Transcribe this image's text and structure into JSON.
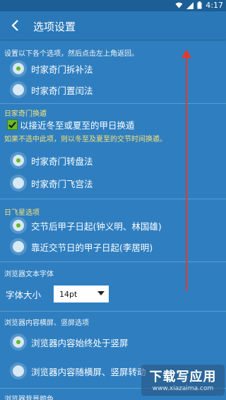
{
  "status_bar": {
    "time": "4:17"
  },
  "app_bar": {
    "title": "选项设置"
  },
  "intro_hint": "设置以下各个选项，然后点击左上角返回。",
  "qimen_method": {
    "options": [
      {
        "label": "时家奇门拆补法",
        "checked": true
      },
      {
        "label": "时家奇门置闰法",
        "checked": false
      }
    ]
  },
  "jiaqi": {
    "section": "日家奇门换遁",
    "checkbox_label": "以接近冬至或夏至的甲日换遁",
    "checkbox_checked": true,
    "note": "如果不选中此项，则以冬至及夏至的交节时间换遁。"
  },
  "pan_method": {
    "options": [
      {
        "label": "时家奇门转盘法",
        "checked": true
      },
      {
        "label": "时家奇门飞宫法",
        "checked": false
      }
    ]
  },
  "rifei": {
    "section": "日飞星选项",
    "options": [
      {
        "label": "交节后甲子日起(钟义明、林国雄)",
        "checked": true
      },
      {
        "label": "靠近交节日的甲子日起(李居明)",
        "checked": false
      }
    ]
  },
  "browser_font": {
    "section": "浏览器文本字体",
    "label": "字体大小",
    "value": "14pt"
  },
  "browser_orientation": {
    "section": "浏览器内容横屏、竖屏选项",
    "options": [
      {
        "label": "浏览器内容始终处于竖屏",
        "checked": true
      },
      {
        "label": "浏览器内容随横屏、竖屏转动",
        "checked": false
      }
    ]
  },
  "browser_bg": {
    "section": "浏览器背景颜色"
  },
  "watermark": {
    "line1": "下载写应用",
    "line2": "www.xiazaima.com"
  },
  "colors": {
    "background": "#2f7fc0",
    "accent_green": "#67b825",
    "arrow": "#e03a2c"
  }
}
